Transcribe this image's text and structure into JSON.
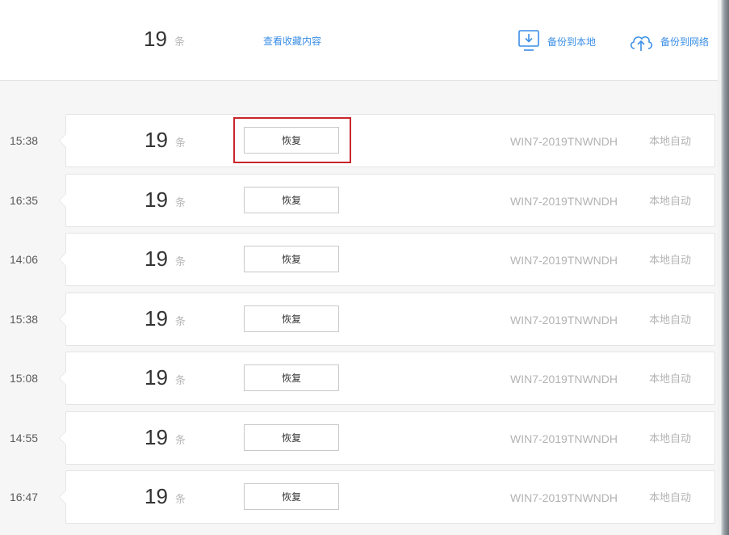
{
  "header": {
    "count": "19",
    "unit": "条",
    "view_favorites_label": "查看收藏内容",
    "backup_local_label": "备份到本地",
    "backup_network_label": "备份到网络",
    "accent_color": "#3a8ee6"
  },
  "records": [
    {
      "time": "15:38",
      "count": "19",
      "unit": "条",
      "restore_label": "恢复",
      "machine": "WIN7-2019TNWNDH",
      "type": "本地自动"
    },
    {
      "time": "16:35",
      "count": "19",
      "unit": "条",
      "restore_label": "恢复",
      "machine": "WIN7-2019TNWNDH",
      "type": "本地自动"
    },
    {
      "time": "14:06",
      "count": "19",
      "unit": "条",
      "restore_label": "恢复",
      "machine": "WIN7-2019TNWNDH",
      "type": "本地自动"
    },
    {
      "time": "15:38",
      "count": "19",
      "unit": "条",
      "restore_label": "恢复",
      "machine": "WIN7-2019TNWNDH",
      "type": "本地自动"
    },
    {
      "time": "15:08",
      "count": "19",
      "unit": "条",
      "restore_label": "恢复",
      "machine": "WIN7-2019TNWNDH",
      "type": "本地自动"
    },
    {
      "time": "14:55",
      "count": "19",
      "unit": "条",
      "restore_label": "恢复",
      "machine": "WIN7-2019TNWNDH",
      "type": "本地自动"
    },
    {
      "time": "16:47",
      "count": "19",
      "unit": "条",
      "restore_label": "恢复",
      "machine": "WIN7-2019TNWNDH",
      "type": "本地自动"
    }
  ],
  "highlight_color": "#c8262a"
}
